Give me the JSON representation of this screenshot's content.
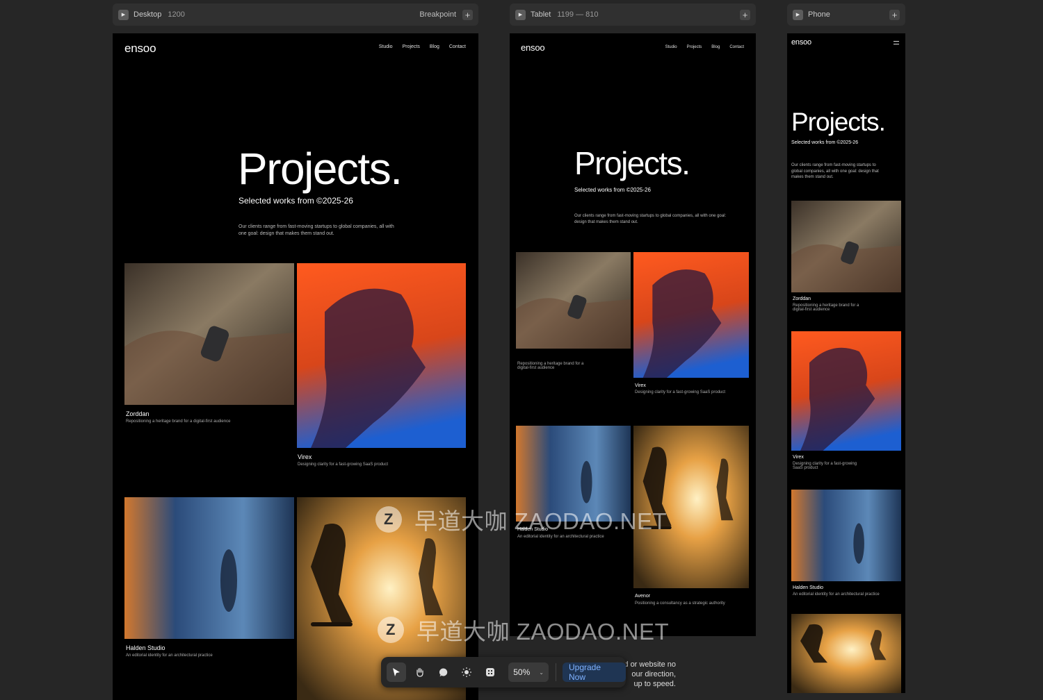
{
  "breakpoints": {
    "desktop": {
      "name": "Desktop",
      "size": "1200",
      "breakpoint_label": "Breakpoint"
    },
    "tablet": {
      "name": "Tablet",
      "size": "1199 — 810"
    },
    "phone": {
      "name": "Phone"
    }
  },
  "site": {
    "logo": "ensoo",
    "nav": [
      "Studio",
      "Projects",
      "Blog",
      "Contact"
    ],
    "heading": "Projects.",
    "subheading": "Selected works from ©2025-26",
    "intro": "Our clients range from fast-moving startups to global companies, all with one goal: design that makes them stand out.",
    "projects": [
      {
        "title": "Zorddan",
        "desc": "Repositioning a heritage brand for a digital-first audience"
      },
      {
        "title": "Virex",
        "desc": "Designing clarity for a fast-growing SaaS product"
      },
      {
        "title": "Halden Studio",
        "desc": "An editorial identity for an architectural practice"
      },
      {
        "title": "Avenor",
        "desc": "Positioning a consultancy as a strategic authority"
      }
    ]
  },
  "toolbar": {
    "tools": [
      "select-icon",
      "hand-icon",
      "comment-icon",
      "theme-icon",
      "components-icon"
    ],
    "zoom": "50%",
    "upgrade_label": "Upgrade Now"
  },
  "partial_text": "d or website no\nour direction,\n up to speed.",
  "watermark": {
    "text": "早道大咖  ZAODAO.NET",
    "logo_letter": "Z"
  },
  "colors": {
    "background": "#262626",
    "frame": "#000000",
    "accent": "#7fb2ff"
  }
}
